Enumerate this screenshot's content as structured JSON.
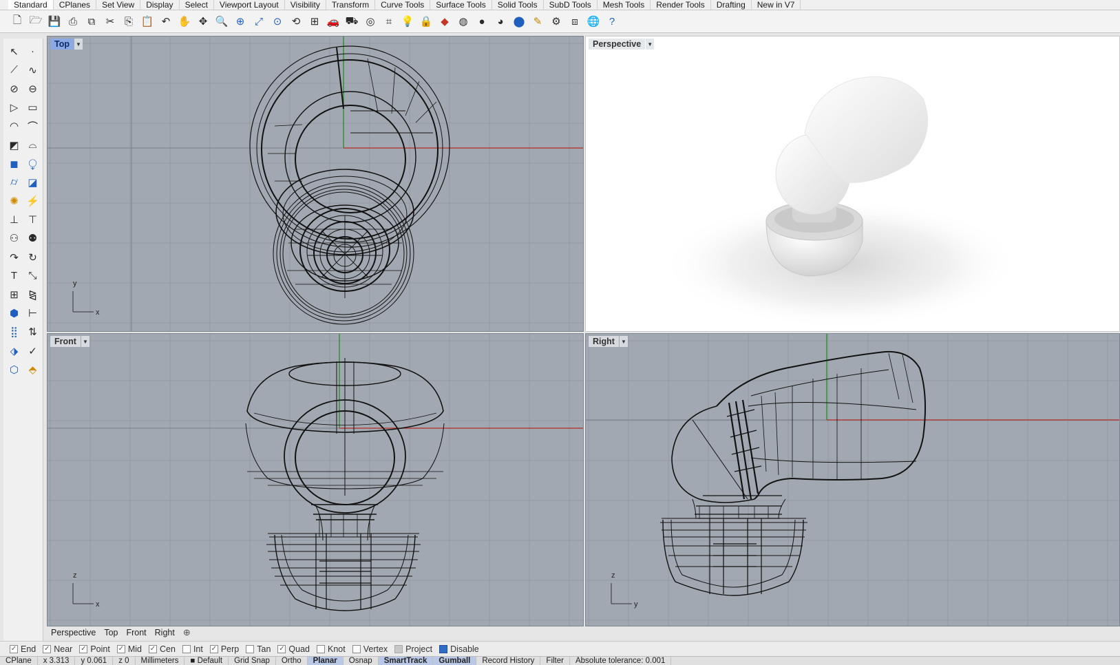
{
  "tabs": [
    "Standard",
    "CPlanes",
    "Set View",
    "Display",
    "Select",
    "Viewport Layout",
    "Visibility",
    "Transform",
    "Curve Tools",
    "Surface Tools",
    "Solid Tools",
    "SubD Tools",
    "Mesh Tools",
    "Render Tools",
    "Drafting",
    "New in V7"
  ],
  "toolbar_icons": [
    {
      "name": "new-file-icon",
      "glyph": "🗋"
    },
    {
      "name": "open-file-icon",
      "glyph": "🗁"
    },
    {
      "name": "save-icon",
      "glyph": "💾"
    },
    {
      "name": "print-icon",
      "glyph": "⎙"
    },
    {
      "name": "export-icon",
      "glyph": "⧉"
    },
    {
      "name": "cut-icon",
      "glyph": "✂"
    },
    {
      "name": "copy-icon",
      "glyph": "⎘"
    },
    {
      "name": "paste-icon",
      "glyph": "📋"
    },
    {
      "name": "undo-icon",
      "glyph": "↶"
    },
    {
      "name": "pan-hand-icon",
      "glyph": "✋"
    },
    {
      "name": "move-view-icon",
      "glyph": "✥"
    },
    {
      "name": "zoom-icon",
      "glyph": "🔍"
    },
    {
      "name": "zoom-window-icon",
      "glyph": "⊕"
    },
    {
      "name": "zoom-extents-icon",
      "glyph": "⤢"
    },
    {
      "name": "zoom-selected-icon",
      "glyph": "⊙"
    },
    {
      "name": "rotate-view-icon",
      "glyph": "⟲"
    },
    {
      "name": "four-viewports-icon",
      "glyph": "⊞"
    },
    {
      "name": "named-view-car-icon",
      "glyph": "🚗"
    },
    {
      "name": "camera-icon",
      "glyph": "⛟"
    },
    {
      "name": "target-icon",
      "glyph": "◎"
    },
    {
      "name": "grid-snap-icon",
      "glyph": "⌗"
    },
    {
      "name": "light-bulb-icon",
      "glyph": "💡"
    },
    {
      "name": "lock-icon",
      "glyph": "🔒"
    },
    {
      "name": "layer-icon",
      "glyph": "◆"
    },
    {
      "name": "color-wheel-icon",
      "glyph": "◍"
    },
    {
      "name": "material-sphere-icon",
      "glyph": "●"
    },
    {
      "name": "render-sphere-icon",
      "glyph": "◕"
    },
    {
      "name": "render-blue-icon",
      "glyph": "⬤"
    },
    {
      "name": "highlight-icon",
      "glyph": "✎"
    },
    {
      "name": "settings-gear-icon",
      "glyph": "⚙"
    },
    {
      "name": "options-icon",
      "glyph": "⧈"
    },
    {
      "name": "globe-icon",
      "glyph": "🌐"
    },
    {
      "name": "help-icon",
      "glyph": "?"
    }
  ],
  "left_tools": [
    {
      "name": "select-arrow-icon",
      "glyph": "↖"
    },
    {
      "name": "point-icon",
      "glyph": "·"
    },
    {
      "name": "polyline-icon",
      "glyph": "⟋"
    },
    {
      "name": "curve-icon",
      "glyph": "∿"
    },
    {
      "name": "circle-icon",
      "glyph": "⊘"
    },
    {
      "name": "ellipse-icon",
      "glyph": "⊖"
    },
    {
      "name": "polygon-icon",
      "glyph": "▷"
    },
    {
      "name": "rectangle-icon",
      "glyph": "▭"
    },
    {
      "name": "arc-icon",
      "glyph": "◠"
    },
    {
      "name": "fillet-curve-icon",
      "glyph": "⌒"
    },
    {
      "name": "surface-corners-icon",
      "glyph": "◩"
    },
    {
      "name": "loft-icon",
      "glyph": "⌓"
    },
    {
      "name": "box-solid-icon",
      "glyph": "◼"
    },
    {
      "name": "boolean-icon",
      "glyph": "⧬"
    },
    {
      "name": "cylinder-icon",
      "glyph": "⌭"
    },
    {
      "name": "plane-surface-icon",
      "glyph": "◪"
    },
    {
      "name": "explode-icon",
      "glyph": "✺"
    },
    {
      "name": "split-icon",
      "glyph": "⚡"
    },
    {
      "name": "extrude-icon",
      "glyph": "⊥"
    },
    {
      "name": "offset-icon",
      "glyph": "⊤"
    },
    {
      "name": "group-icon",
      "glyph": "⚇"
    },
    {
      "name": "block-icon",
      "glyph": "⚉"
    },
    {
      "name": "move-icon",
      "glyph": "↷"
    },
    {
      "name": "rotate-icon",
      "glyph": "↻"
    },
    {
      "name": "text-icon",
      "glyph": "T"
    },
    {
      "name": "scale-icon",
      "glyph": "⤡"
    },
    {
      "name": "array-icon",
      "glyph": "⊞"
    },
    {
      "name": "mirror-icon",
      "glyph": "⧎"
    },
    {
      "name": "cplane-icon",
      "glyph": "⬢"
    },
    {
      "name": "dimension-icon",
      "glyph": "⊢"
    },
    {
      "name": "grid-array-icon",
      "glyph": "⣿"
    },
    {
      "name": "transform-icon",
      "glyph": "⇅"
    },
    {
      "name": "analyze-icon",
      "glyph": "⬗"
    },
    {
      "name": "check-icon",
      "glyph": "✓"
    },
    {
      "name": "mesh-icon",
      "glyph": "⬡"
    },
    {
      "name": "render-tool-icon",
      "glyph": "⬘"
    }
  ],
  "viewports": {
    "top": {
      "label": "Top",
      "axis1": "y",
      "axis2": "x"
    },
    "perspective": {
      "label": "Perspective"
    },
    "front": {
      "label": "Front",
      "axis1": "z",
      "axis2": "x"
    },
    "right": {
      "label": "Right",
      "axis1": "z",
      "axis2": "y"
    }
  },
  "viewport_tabs": [
    "Perspective",
    "Top",
    "Front",
    "Right"
  ],
  "add_tab_glyph": "⊕",
  "osnaps": [
    {
      "label": "End",
      "checked": true
    },
    {
      "label": "Near",
      "checked": true
    },
    {
      "label": "Point",
      "checked": true
    },
    {
      "label": "Mid",
      "checked": true
    },
    {
      "label": "Cen",
      "checked": true
    },
    {
      "label": "Int",
      "checked": false
    },
    {
      "label": "Perp",
      "checked": true
    },
    {
      "label": "Tan",
      "checked": false
    },
    {
      "label": "Quad",
      "checked": true
    },
    {
      "label": "Knot",
      "checked": false
    },
    {
      "label": "Vertex",
      "checked": false
    },
    {
      "label": "Project",
      "checked": false,
      "disabled": true
    },
    {
      "label": "Disable",
      "checked": false,
      "blue": true
    }
  ],
  "statusbar": [
    {
      "text": "CPlane",
      "bold": false
    },
    {
      "text": "x 3.313",
      "bold": false
    },
    {
      "text": "y 0.061",
      "bold": false
    },
    {
      "text": "z 0",
      "bold": false
    },
    {
      "text": "Millimeters",
      "bold": false
    },
    {
      "text": "■ Default",
      "bold": false
    },
    {
      "text": "Grid Snap",
      "bold": false
    },
    {
      "text": "Ortho",
      "bold": false
    },
    {
      "text": "Planar",
      "bold": true,
      "hl": true
    },
    {
      "text": "Osnap",
      "bold": false
    },
    {
      "text": "SmartTrack",
      "bold": true,
      "hl": true
    },
    {
      "text": "Gumball",
      "bold": true,
      "hl": true
    },
    {
      "text": "Record History",
      "bold": false
    },
    {
      "text": "Filter",
      "bold": false
    },
    {
      "text": "Absolute tolerance: 0.001",
      "bold": false
    }
  ],
  "colors": {
    "viewport_bg": "#a2a8b1",
    "grid": "#8f959e",
    "x_axis": "#b32a22",
    "y_axis": "#1a8a1a",
    "active_title": "#8da9e4"
  }
}
